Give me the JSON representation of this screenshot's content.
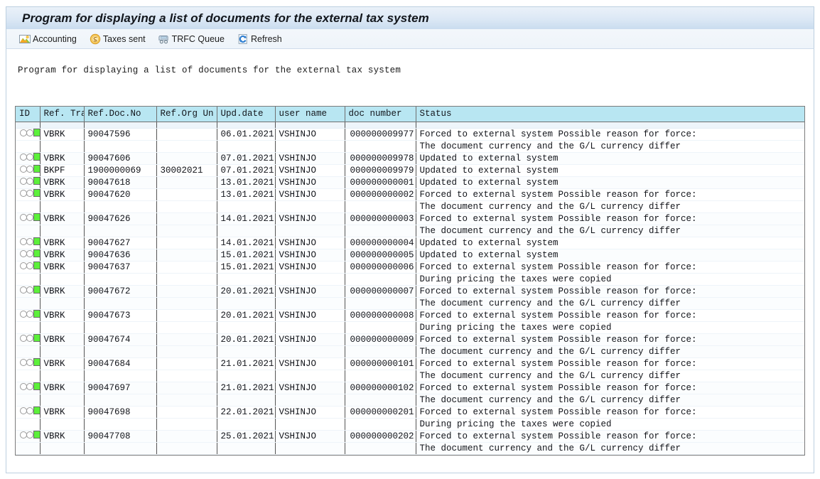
{
  "window": {
    "title": "Program for displaying a list of documents for the external tax system"
  },
  "toolbar": {
    "buttons": [
      {
        "label": "Accounting",
        "icon": "accounting-icon"
      },
      {
        "label": "Taxes sent",
        "icon": "taxes-sent-icon"
      },
      {
        "label": "TRFC Queue",
        "icon": "trfc-queue-icon"
      },
      {
        "label": "Refresh",
        "icon": "refresh-icon"
      }
    ]
  },
  "report": {
    "subtitle": "Program for displaying a list of documents for the external tax system"
  },
  "grid": {
    "columns": [
      "ID",
      "Ref. Tran.",
      "Ref.Doc.No",
      "Ref.Org Un",
      "Upd.date",
      "user name",
      "doc number",
      "Status"
    ],
    "status_icon": "traffic-light-green-icon",
    "rows": [
      {
        "ref_tran": "VBRK",
        "ref_doc_no": "90047596",
        "ref_org_un": "",
        "upd_date": "06.01.2021",
        "user_name": "VSHINJO",
        "doc_number": "000000009977",
        "status": "Forced to external system Possible reason for force:",
        "status2": "The document currency and the G/L currency differ"
      },
      {
        "ref_tran": "VBRK",
        "ref_doc_no": "90047606",
        "ref_org_un": "",
        "upd_date": "07.01.2021",
        "user_name": "VSHINJO",
        "doc_number": "000000009978",
        "status": "Updated to external system",
        "status2": ""
      },
      {
        "ref_tran": "BKPF",
        "ref_doc_no": "1900000069",
        "ref_org_un": "30002021",
        "upd_date": "07.01.2021",
        "user_name": "VSHINJO",
        "doc_number": "000000009979",
        "status": "Updated to external system",
        "status2": ""
      },
      {
        "ref_tran": "VBRK",
        "ref_doc_no": "90047618",
        "ref_org_un": "",
        "upd_date": "13.01.2021",
        "user_name": "VSHINJO",
        "doc_number": "000000000001",
        "status": "Updated to external system",
        "status2": ""
      },
      {
        "ref_tran": "VBRK",
        "ref_doc_no": "90047620",
        "ref_org_un": "",
        "upd_date": "13.01.2021",
        "user_name": "VSHINJO",
        "doc_number": "000000000002",
        "status": "Forced to external system Possible reason for force:",
        "status2": "The document currency and the G/L currency differ"
      },
      {
        "ref_tran": "VBRK",
        "ref_doc_no": "90047626",
        "ref_org_un": "",
        "upd_date": "14.01.2021",
        "user_name": "VSHINJO",
        "doc_number": "000000000003",
        "status": "Forced to external system Possible reason for force:",
        "status2": "The document currency and the G/L currency differ"
      },
      {
        "ref_tran": "VBRK",
        "ref_doc_no": "90047627",
        "ref_org_un": "",
        "upd_date": "14.01.2021",
        "user_name": "VSHINJO",
        "doc_number": "000000000004",
        "status": "Updated to external system",
        "status2": ""
      },
      {
        "ref_tran": "VBRK",
        "ref_doc_no": "90047636",
        "ref_org_un": "",
        "upd_date": "15.01.2021",
        "user_name": "VSHINJO",
        "doc_number": "000000000005",
        "status": "Updated to external system",
        "status2": ""
      },
      {
        "ref_tran": "VBRK",
        "ref_doc_no": "90047637",
        "ref_org_un": "",
        "upd_date": "15.01.2021",
        "user_name": "VSHINJO",
        "doc_number": "000000000006",
        "status": "Forced to external system Possible reason for force:",
        "status2": "During pricing the taxes were copied"
      },
      {
        "ref_tran": "VBRK",
        "ref_doc_no": "90047672",
        "ref_org_un": "",
        "upd_date": "20.01.2021",
        "user_name": "VSHINJO",
        "doc_number": "000000000007",
        "status": "Forced to external system Possible reason for force:",
        "status2": "The document currency and the G/L currency differ"
      },
      {
        "ref_tran": "VBRK",
        "ref_doc_no": "90047673",
        "ref_org_un": "",
        "upd_date": "20.01.2021",
        "user_name": "VSHINJO",
        "doc_number": "000000000008",
        "status": "Forced to external system Possible reason for force:",
        "status2": "During pricing the taxes were copied"
      },
      {
        "ref_tran": "VBRK",
        "ref_doc_no": "90047674",
        "ref_org_un": "",
        "upd_date": "20.01.2021",
        "user_name": "VSHINJO",
        "doc_number": "000000000009",
        "status": "Forced to external system Possible reason for force:",
        "status2": "The document currency and the G/L currency differ"
      },
      {
        "ref_tran": "VBRK",
        "ref_doc_no": "90047684",
        "ref_org_un": "",
        "upd_date": "21.01.2021",
        "user_name": "VSHINJO",
        "doc_number": "000000000101",
        "status": "Forced to external system Possible reason for force:",
        "status2": "The document currency and the G/L currency differ"
      },
      {
        "ref_tran": "VBRK",
        "ref_doc_no": "90047697",
        "ref_org_un": "",
        "upd_date": "21.01.2021",
        "user_name": "VSHINJO",
        "doc_number": "000000000102",
        "status": "Forced to external system Possible reason for force:",
        "status2": "The document currency and the G/L currency differ"
      },
      {
        "ref_tran": "VBRK",
        "ref_doc_no": "90047698",
        "ref_org_un": "",
        "upd_date": "22.01.2021",
        "user_name": "VSHINJO",
        "doc_number": "000000000201",
        "status": "Forced to external system Possible reason for force:",
        "status2": "During pricing the taxes were copied"
      },
      {
        "ref_tran": "VBRK",
        "ref_doc_no": "90047708",
        "ref_org_un": "",
        "upd_date": "25.01.2021",
        "user_name": "VSHINJO",
        "doc_number": "000000000202",
        "status": "Forced to external system Possible reason for force:",
        "status2": "The document currency and the G/L currency differ"
      }
    ]
  },
  "colors": {
    "header_cell": "#b8e6f2",
    "title_bar": "#dce8f5",
    "traffic_green": "#5cf03a"
  }
}
